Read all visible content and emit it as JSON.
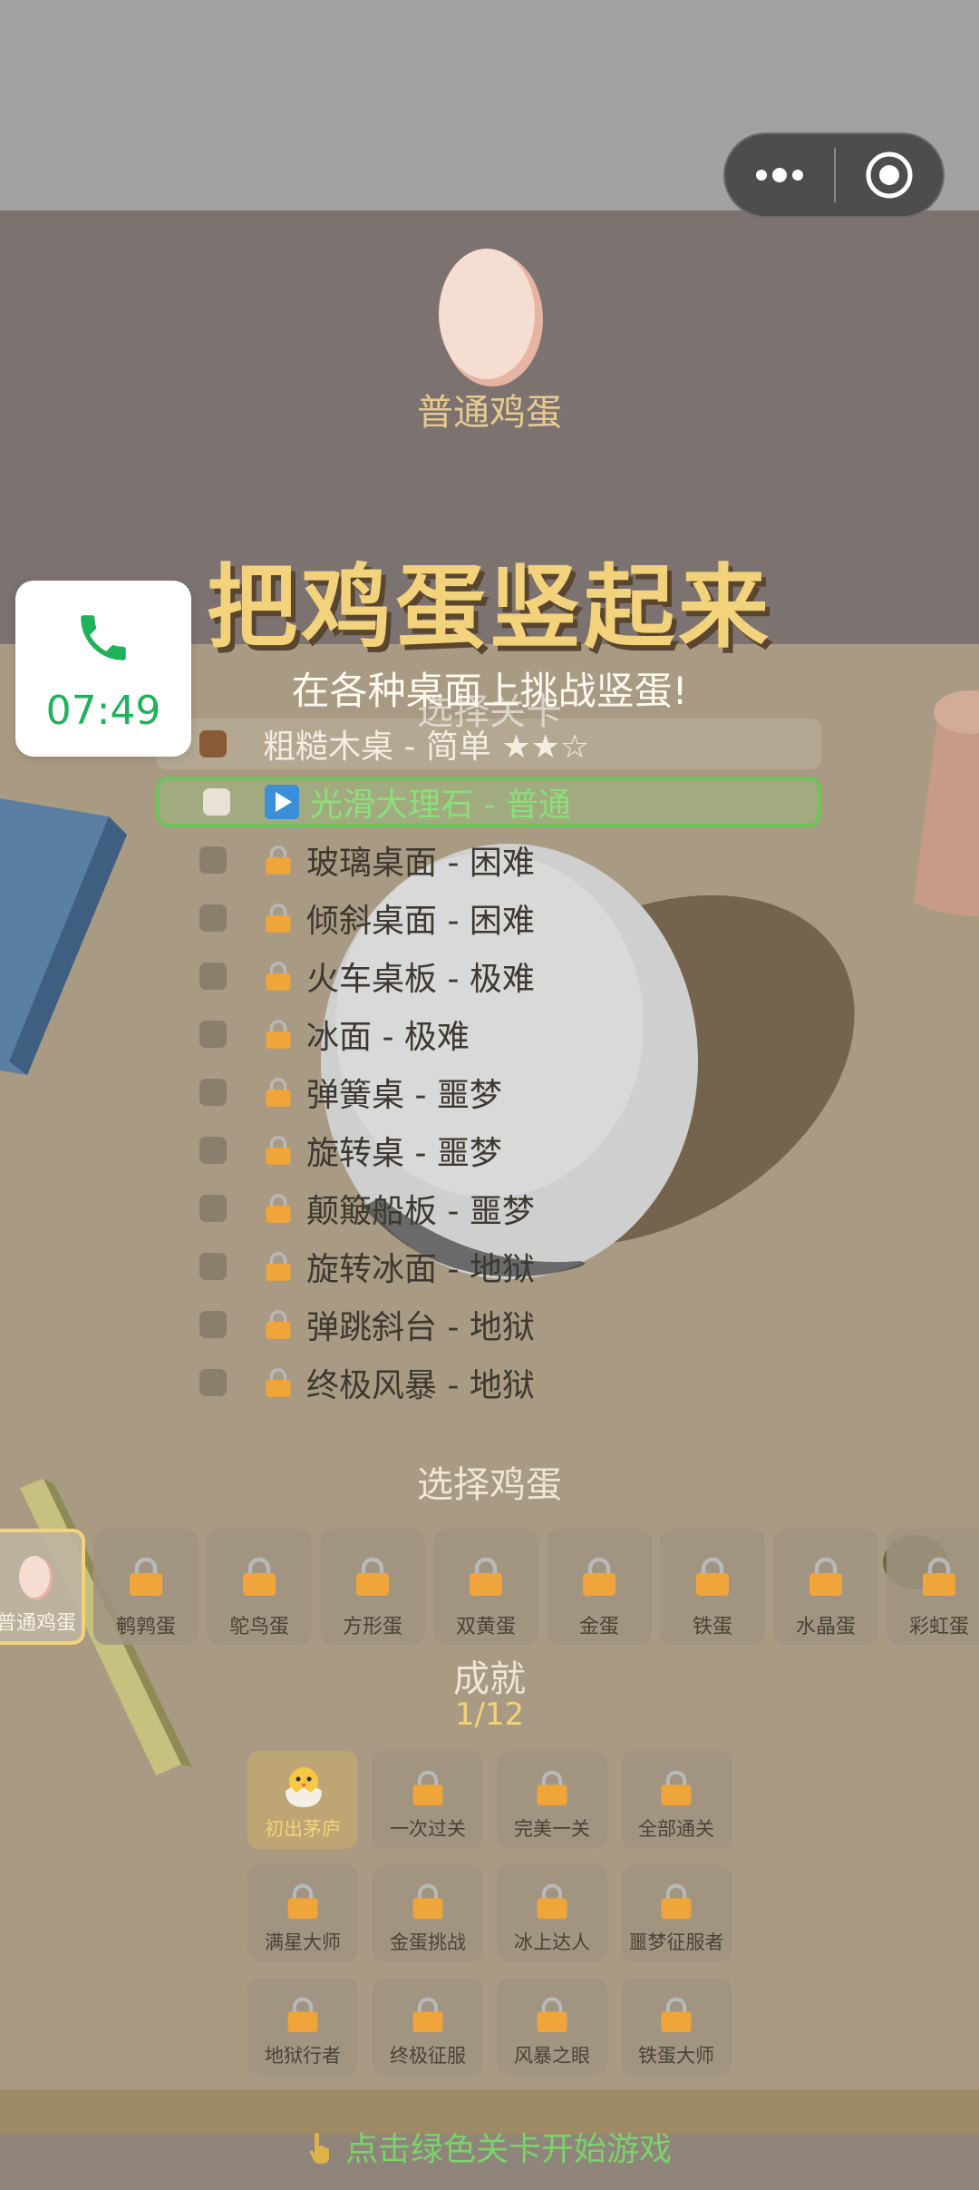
{
  "hero": {
    "egg_name": "普通鸡蛋"
  },
  "title": "把鸡蛋竖起来",
  "subtitle": "在各种桌面上挑战竖蛋!",
  "call": {
    "time": "07:49"
  },
  "levels": {
    "header": "选择关卡",
    "items": [
      {
        "label": "粗糙木桌 - 简单 ★★☆",
        "state": "done"
      },
      {
        "label": "光滑大理石 - 普通",
        "state": "current"
      },
      {
        "label": "玻璃桌面 - 困难",
        "state": "locked"
      },
      {
        "label": "倾斜桌面 - 困难",
        "state": "locked"
      },
      {
        "label": "火车桌板 - 极难",
        "state": "locked"
      },
      {
        "label": "冰面 - 极难",
        "state": "locked"
      },
      {
        "label": "弹簧桌 - 噩梦",
        "state": "locked"
      },
      {
        "label": "旋转桌 - 噩梦",
        "state": "locked"
      },
      {
        "label": "颠簸船板 - 噩梦",
        "state": "locked"
      },
      {
        "label": "旋转冰面 - 地狱",
        "state": "locked"
      },
      {
        "label": "弹跳斜台 - 地狱",
        "state": "locked"
      },
      {
        "label": "终极风暴 - 地狱",
        "state": "locked"
      }
    ]
  },
  "eggs": {
    "header": "选择鸡蛋",
    "items": [
      {
        "name": "普通鸡蛋",
        "selected": true
      },
      {
        "name": "鹌鹑蛋"
      },
      {
        "name": "鸵鸟蛋"
      },
      {
        "name": "方形蛋"
      },
      {
        "name": "双黄蛋"
      },
      {
        "name": "金蛋"
      },
      {
        "name": "铁蛋"
      },
      {
        "name": "水晶蛋"
      },
      {
        "name": "彩虹蛋"
      }
    ]
  },
  "achievements": {
    "header": "成就",
    "count": "1/12",
    "items": [
      {
        "name": "初出茅庐",
        "unlocked": true
      },
      {
        "name": "一次过关"
      },
      {
        "name": "完美一关"
      },
      {
        "name": "全部通关"
      },
      {
        "name": "满星大师"
      },
      {
        "name": "金蛋挑战"
      },
      {
        "name": "冰上达人"
      },
      {
        "name": "噩梦征服者"
      },
      {
        "name": "地狱行者"
      },
      {
        "name": "终极征服"
      },
      {
        "name": "风暴之眼"
      },
      {
        "name": "铁蛋大师"
      }
    ]
  },
  "footer": {
    "hint": "点击绿色关卡开始游戏"
  },
  "colors": {
    "accent_gold": "#f2d27a",
    "go_green": "#6fc35b",
    "lock_orange": "#f0a53a",
    "table": "#a99b83"
  }
}
